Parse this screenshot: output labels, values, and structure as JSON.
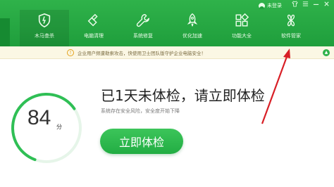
{
  "colors": {
    "brand_green": "#22ad43",
    "notice_bg": "#fbf7e4",
    "annotation_red": "#d81f26"
  },
  "window": {
    "user_label": "未登录",
    "controls": [
      "shirt-icon",
      "menu-icon",
      "minimize-icon",
      "close-icon"
    ]
  },
  "tabs": [
    {
      "label": "木马查杀",
      "icon": "shield-icon"
    },
    {
      "label": "电脑清理",
      "icon": "broom-icon"
    },
    {
      "label": "系统修复",
      "icon": "wrench-icon"
    },
    {
      "label": "优化加速",
      "icon": "rocket-icon"
    },
    {
      "label": "功能大全",
      "icon": "grid-icon"
    },
    {
      "label": "软件管家",
      "icon": "software-icon"
    }
  ],
  "notice": {
    "text": "企业用户频遭勒索攻击，快使用卫士团队版守护企业电脑安全！"
  },
  "score": {
    "value": "84",
    "unit": "分"
  },
  "main": {
    "headline": "已1天未体检，请立即体检",
    "subline": "系统存在安全风险，安全度开始下降",
    "button_label": "立即体检"
  }
}
